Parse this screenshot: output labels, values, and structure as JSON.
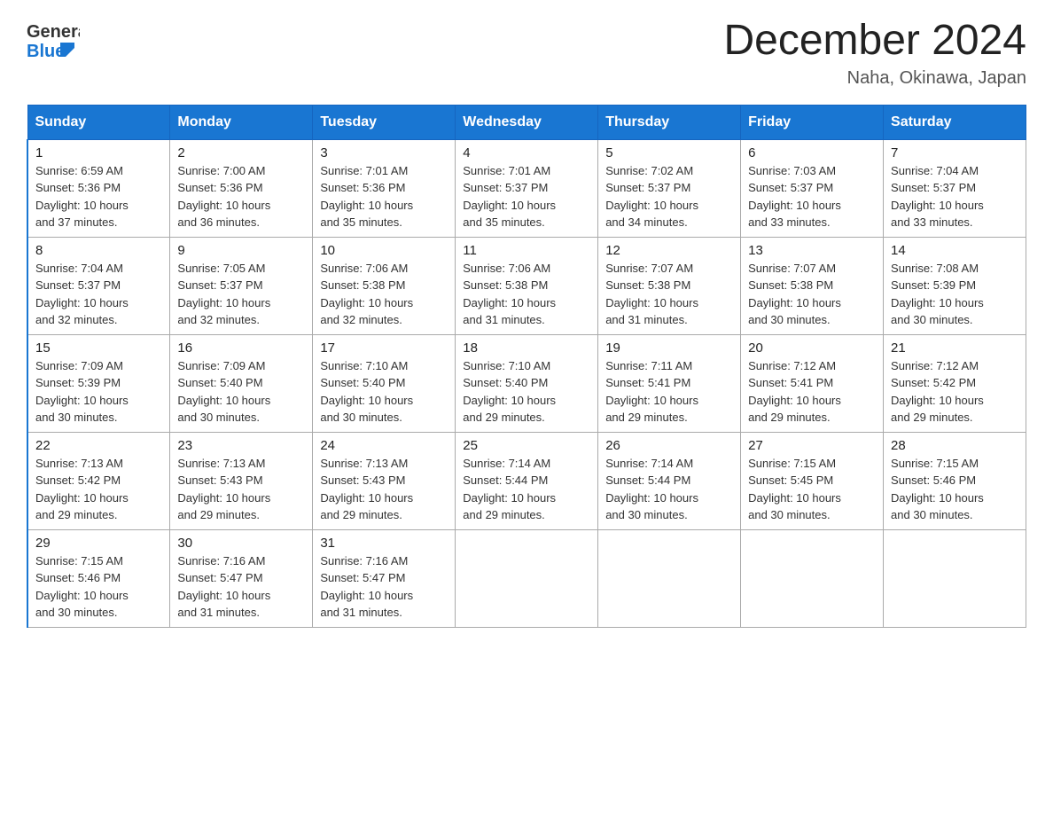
{
  "header": {
    "logo_general": "General",
    "logo_blue": "Blue",
    "month_title": "December 2024",
    "location": "Naha, Okinawa, Japan"
  },
  "days_of_week": [
    "Sunday",
    "Monday",
    "Tuesday",
    "Wednesday",
    "Thursday",
    "Friday",
    "Saturday"
  ],
  "weeks": [
    [
      {
        "day": "1",
        "sunrise": "6:59 AM",
        "sunset": "5:36 PM",
        "daylight": "10 hours and 37 minutes."
      },
      {
        "day": "2",
        "sunrise": "7:00 AM",
        "sunset": "5:36 PM",
        "daylight": "10 hours and 36 minutes."
      },
      {
        "day": "3",
        "sunrise": "7:01 AM",
        "sunset": "5:36 PM",
        "daylight": "10 hours and 35 minutes."
      },
      {
        "day": "4",
        "sunrise": "7:01 AM",
        "sunset": "5:37 PM",
        "daylight": "10 hours and 35 minutes."
      },
      {
        "day": "5",
        "sunrise": "7:02 AM",
        "sunset": "5:37 PM",
        "daylight": "10 hours and 34 minutes."
      },
      {
        "day": "6",
        "sunrise": "7:03 AM",
        "sunset": "5:37 PM",
        "daylight": "10 hours and 33 minutes."
      },
      {
        "day": "7",
        "sunrise": "7:04 AM",
        "sunset": "5:37 PM",
        "daylight": "10 hours and 33 minutes."
      }
    ],
    [
      {
        "day": "8",
        "sunrise": "7:04 AM",
        "sunset": "5:37 PM",
        "daylight": "10 hours and 32 minutes."
      },
      {
        "day": "9",
        "sunrise": "7:05 AM",
        "sunset": "5:37 PM",
        "daylight": "10 hours and 32 minutes."
      },
      {
        "day": "10",
        "sunrise": "7:06 AM",
        "sunset": "5:38 PM",
        "daylight": "10 hours and 32 minutes."
      },
      {
        "day": "11",
        "sunrise": "7:06 AM",
        "sunset": "5:38 PM",
        "daylight": "10 hours and 31 minutes."
      },
      {
        "day": "12",
        "sunrise": "7:07 AM",
        "sunset": "5:38 PM",
        "daylight": "10 hours and 31 minutes."
      },
      {
        "day": "13",
        "sunrise": "7:07 AM",
        "sunset": "5:38 PM",
        "daylight": "10 hours and 30 minutes."
      },
      {
        "day": "14",
        "sunrise": "7:08 AM",
        "sunset": "5:39 PM",
        "daylight": "10 hours and 30 minutes."
      }
    ],
    [
      {
        "day": "15",
        "sunrise": "7:09 AM",
        "sunset": "5:39 PM",
        "daylight": "10 hours and 30 minutes."
      },
      {
        "day": "16",
        "sunrise": "7:09 AM",
        "sunset": "5:40 PM",
        "daylight": "10 hours and 30 minutes."
      },
      {
        "day": "17",
        "sunrise": "7:10 AM",
        "sunset": "5:40 PM",
        "daylight": "10 hours and 30 minutes."
      },
      {
        "day": "18",
        "sunrise": "7:10 AM",
        "sunset": "5:40 PM",
        "daylight": "10 hours and 29 minutes."
      },
      {
        "day": "19",
        "sunrise": "7:11 AM",
        "sunset": "5:41 PM",
        "daylight": "10 hours and 29 minutes."
      },
      {
        "day": "20",
        "sunrise": "7:12 AM",
        "sunset": "5:41 PM",
        "daylight": "10 hours and 29 minutes."
      },
      {
        "day": "21",
        "sunrise": "7:12 AM",
        "sunset": "5:42 PM",
        "daylight": "10 hours and 29 minutes."
      }
    ],
    [
      {
        "day": "22",
        "sunrise": "7:13 AM",
        "sunset": "5:42 PM",
        "daylight": "10 hours and 29 minutes."
      },
      {
        "day": "23",
        "sunrise": "7:13 AM",
        "sunset": "5:43 PM",
        "daylight": "10 hours and 29 minutes."
      },
      {
        "day": "24",
        "sunrise": "7:13 AM",
        "sunset": "5:43 PM",
        "daylight": "10 hours and 29 minutes."
      },
      {
        "day": "25",
        "sunrise": "7:14 AM",
        "sunset": "5:44 PM",
        "daylight": "10 hours and 29 minutes."
      },
      {
        "day": "26",
        "sunrise": "7:14 AM",
        "sunset": "5:44 PM",
        "daylight": "10 hours and 30 minutes."
      },
      {
        "day": "27",
        "sunrise": "7:15 AM",
        "sunset": "5:45 PM",
        "daylight": "10 hours and 30 minutes."
      },
      {
        "day": "28",
        "sunrise": "7:15 AM",
        "sunset": "5:46 PM",
        "daylight": "10 hours and 30 minutes."
      }
    ],
    [
      {
        "day": "29",
        "sunrise": "7:15 AM",
        "sunset": "5:46 PM",
        "daylight": "10 hours and 30 minutes."
      },
      {
        "day": "30",
        "sunrise": "7:16 AM",
        "sunset": "5:47 PM",
        "daylight": "10 hours and 31 minutes."
      },
      {
        "day": "31",
        "sunrise": "7:16 AM",
        "sunset": "5:47 PM",
        "daylight": "10 hours and 31 minutes."
      },
      null,
      null,
      null,
      null
    ]
  ],
  "labels": {
    "sunrise": "Sunrise:",
    "sunset": "Sunset:",
    "daylight": "Daylight:"
  }
}
